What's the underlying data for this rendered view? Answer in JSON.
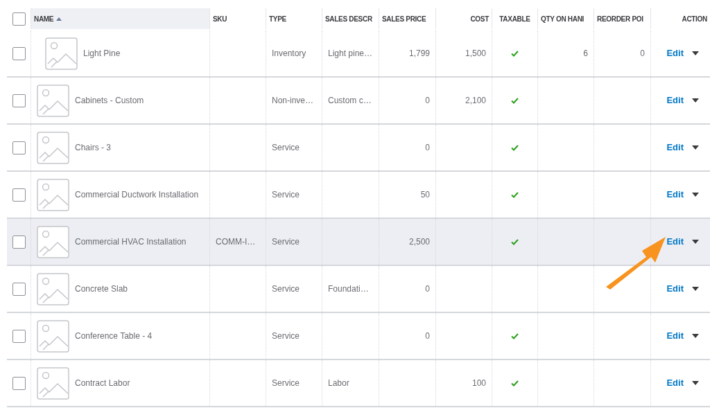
{
  "table": {
    "columns": [
      {
        "label": "NAME",
        "sorted": true
      },
      {
        "label": "SKU",
        "sorted": false
      },
      {
        "label": "TYPE",
        "sorted": false
      },
      {
        "label": "SALES DESCR",
        "sorted": false
      },
      {
        "label": "SALES PRICE",
        "sorted": false
      },
      {
        "label": "COST",
        "sorted": false
      },
      {
        "label": "TAXABLE",
        "sorted": false
      },
      {
        "label": "QTY ON HANI",
        "sorted": false
      },
      {
        "label": "REORDER POI",
        "sorted": false
      },
      {
        "label": "ACTION",
        "sorted": false
      }
    ],
    "header_checked": false,
    "rows": [
      {
        "name": "Light Pine",
        "type": "Inventory",
        "description": "Light pine…",
        "price": "1,799",
        "cost": "1,500",
        "taxable": true,
        "qty": "6",
        "reorder": "0",
        "action": "Edit",
        "checked": false,
        "highlighted": false
      },
      {
        "name": "Cabinets - Custom",
        "type": "Non-inve…",
        "description": "Custom c…",
        "price": "0",
        "cost": "2,100",
        "taxable": true,
        "action": "Edit",
        "checked": false,
        "highlighted": false
      },
      {
        "name": "Chairs - 3",
        "type": "Service",
        "price": "0",
        "taxable": true,
        "action": "Edit",
        "checked": false,
        "highlighted": false
      },
      {
        "name": "Commercial Ductwork Installation",
        "type": "Service",
        "price": "50",
        "taxable": true,
        "action": "Edit",
        "checked": false,
        "highlighted": false
      },
      {
        "name": "Commercial HVAC Installation",
        "sku": "COMM-I…",
        "type": "Service",
        "price": "2,500",
        "taxable": true,
        "action": "Edit",
        "checked": false,
        "highlighted": true
      },
      {
        "name": "Concrete Slab",
        "type": "Service",
        "description": "Foundati…",
        "price": "0",
        "taxable": false,
        "action": "Edit",
        "checked": false,
        "highlighted": false
      },
      {
        "name": "Conference Table - 4",
        "type": "Service",
        "price": "0",
        "taxable": true,
        "action": "Edit",
        "checked": false,
        "highlighted": false
      },
      {
        "name": "Contract Labor",
        "type": "Service",
        "description": "Labor",
        "cost": "100",
        "taxable": true,
        "action": "Edit",
        "checked": false,
        "highlighted": false
      }
    ]
  }
}
